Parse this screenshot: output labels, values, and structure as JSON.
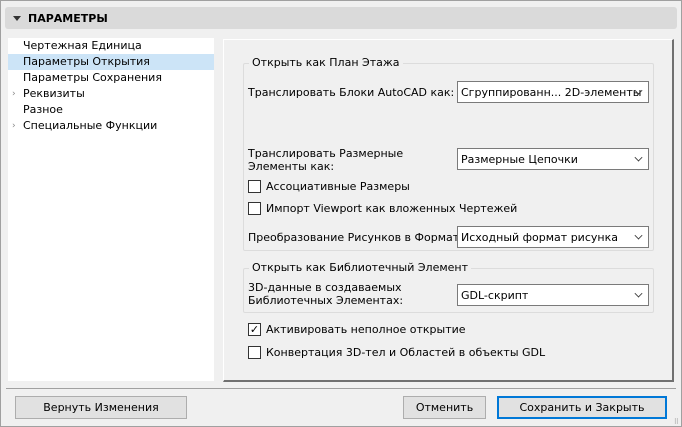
{
  "header": {
    "title": "ПАРАМЕТРЫ"
  },
  "sidebar": {
    "items": [
      {
        "label": "Чертежная Единица",
        "expandable": false,
        "selected": false
      },
      {
        "label": "Параметры Открытия",
        "expandable": false,
        "selected": true
      },
      {
        "label": "Параметры Сохранения",
        "expandable": false,
        "selected": false
      },
      {
        "label": "Реквизиты",
        "expandable": true,
        "selected": false
      },
      {
        "label": "Разное",
        "expandable": false,
        "selected": false
      },
      {
        "label": "Специальные Функции",
        "expandable": true,
        "selected": false
      }
    ]
  },
  "plan": {
    "title": "Открыть как План Этажа",
    "blocks_label": "Транслировать Блоки AutoCAD как:",
    "blocks_value": "Сгруппированн... 2D-элементы",
    "dims_label": "Транслировать Размерные Элементы как:",
    "dims_value": "Размерные Цепочки",
    "assoc_label": "Ассоциативные Размеры",
    "assoc_checked": false,
    "viewport_label": "Импорт Viewport как вложенных Чертежей",
    "viewport_checked": false,
    "images_label": "Преобразование Рисунков в Формат:",
    "images_value": "Исходный формат рисунка"
  },
  "library": {
    "title": "Открыть как Библиотечный Элемент",
    "data3d_label": "3D-данные в создаваемых Библиотечных Элементах:",
    "data3d_value": "GDL-скрипт"
  },
  "partial_label": "Активировать неполное открытие",
  "partial_checked": true,
  "convert_label": "Конвертация 3D-тел и Областей в объекты GDL",
  "convert_checked": false,
  "footer": {
    "revert": "Вернуть Изменения",
    "cancel": "Отменить",
    "save": "Сохранить и Закрыть"
  },
  "colors": {
    "accent": "#0078d7",
    "selection": "#cce4f7"
  }
}
